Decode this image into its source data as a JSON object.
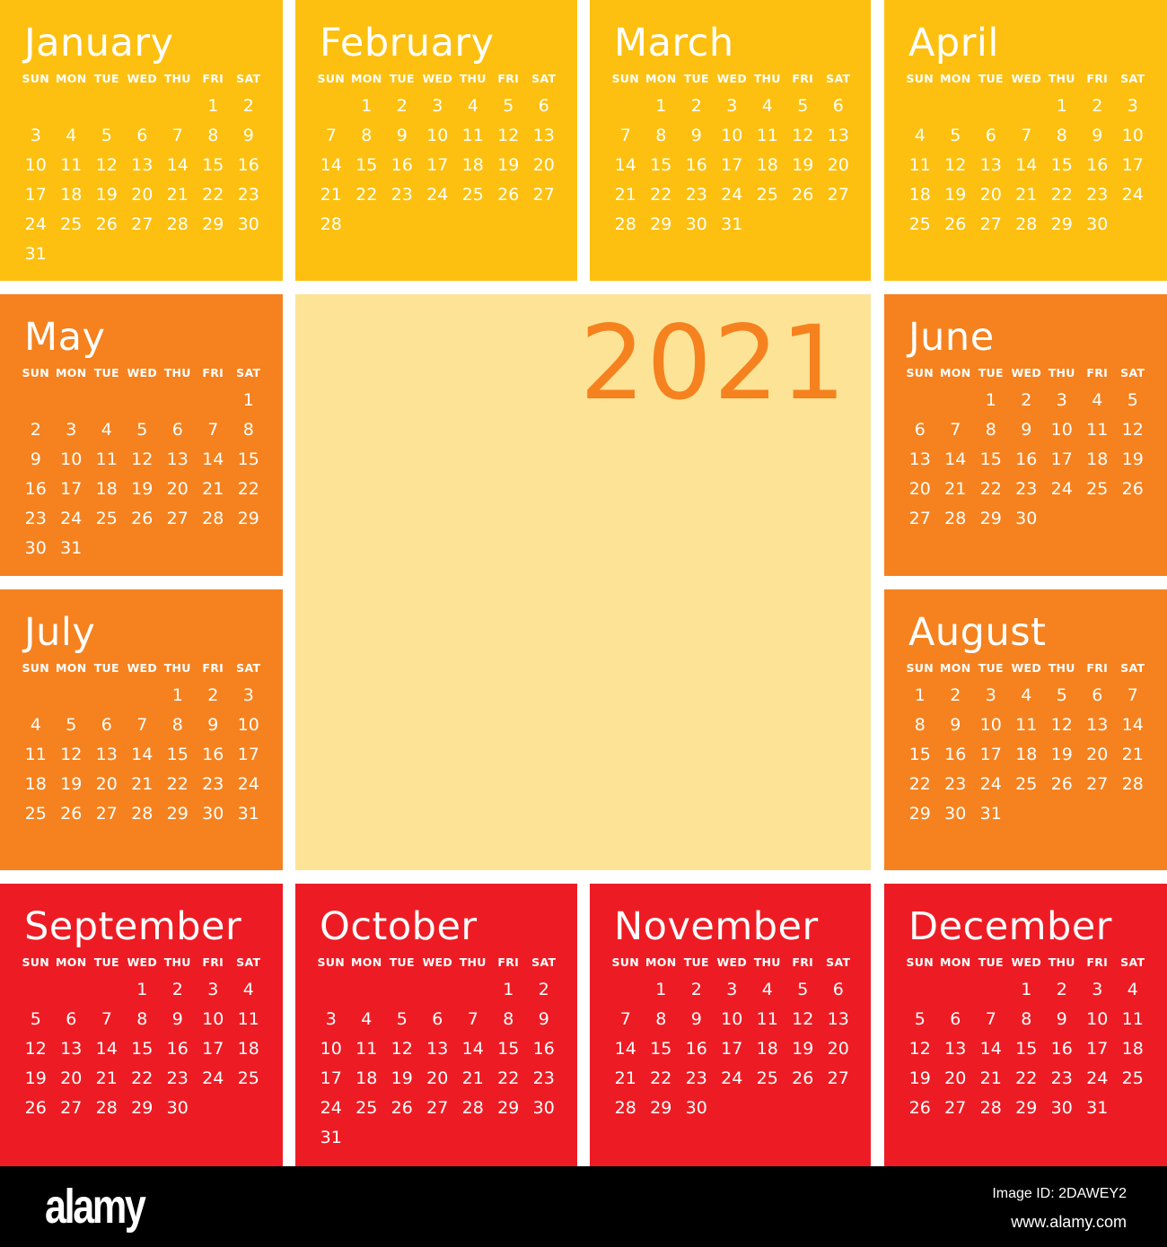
{
  "year": "2021",
  "weekday_labels": [
    "SUN",
    "MON",
    "TUE",
    "WED",
    "THU",
    "FRI",
    "SAT"
  ],
  "colors": {
    "yellow": "#fdc010",
    "orange": "#f5821f",
    "red": "#ed1c24",
    "center": "#fde395",
    "year_text": "#f5821f"
  },
  "months": [
    {
      "name": "January",
      "color": "yellow",
      "start": 5,
      "days": 31
    },
    {
      "name": "February",
      "color": "yellow",
      "start": 1,
      "days": 28
    },
    {
      "name": "March",
      "color": "yellow",
      "start": 1,
      "days": 31
    },
    {
      "name": "April",
      "color": "yellow",
      "start": 4,
      "days": 30
    },
    {
      "name": "May",
      "color": "orange",
      "start": 6,
      "days": 31
    },
    {
      "name": "June",
      "color": "orange",
      "start": 2,
      "days": 30
    },
    {
      "name": "July",
      "color": "orange",
      "start": 4,
      "days": 31
    },
    {
      "name": "August",
      "color": "orange",
      "start": 0,
      "days": 31
    },
    {
      "name": "September",
      "color": "red",
      "start": 3,
      "days": 30
    },
    {
      "name": "October",
      "color": "red",
      "start": 5,
      "days": 31
    },
    {
      "name": "November",
      "color": "red",
      "start": 1,
      "days": 30
    },
    {
      "name": "December",
      "color": "red",
      "start": 3,
      "days": 31
    }
  ],
  "footer": {
    "logo": "alamy",
    "image_id": "Image ID: 2DAWEY2",
    "site": "www.alamy.com"
  }
}
